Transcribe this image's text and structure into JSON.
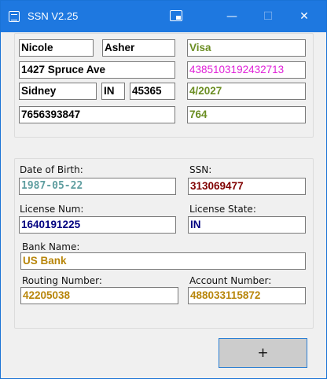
{
  "window": {
    "title": "SSN V2.25"
  },
  "titlebar": {
    "minimize": "—",
    "maximize": "☐",
    "close": "✕"
  },
  "person": {
    "first_name": "Nicole",
    "last_name": "Asher",
    "address": "1427 Spruce Ave",
    "city": "Sidney",
    "state": "IN",
    "zip": "45365",
    "phone": "7656393847"
  },
  "card": {
    "type": "Visa",
    "number": "4385103192432713",
    "expiry": "4/2027",
    "cvv": "764"
  },
  "details": {
    "dob_label": "Date of Birth:",
    "dob": "1987-05-22",
    "ssn_label": "SSN:",
    "ssn": "313069477",
    "license_num_label": "License Num:",
    "license_num": "1640191225",
    "license_state_label": "License State:",
    "license_state": "IN",
    "bank_name_label": "Bank Name:",
    "bank_name": "US Bank",
    "routing_label": "Routing Number:",
    "routing": "42205038",
    "account_label": "Account Number:",
    "account": "488033115872"
  },
  "actions": {
    "add_label": "+"
  }
}
